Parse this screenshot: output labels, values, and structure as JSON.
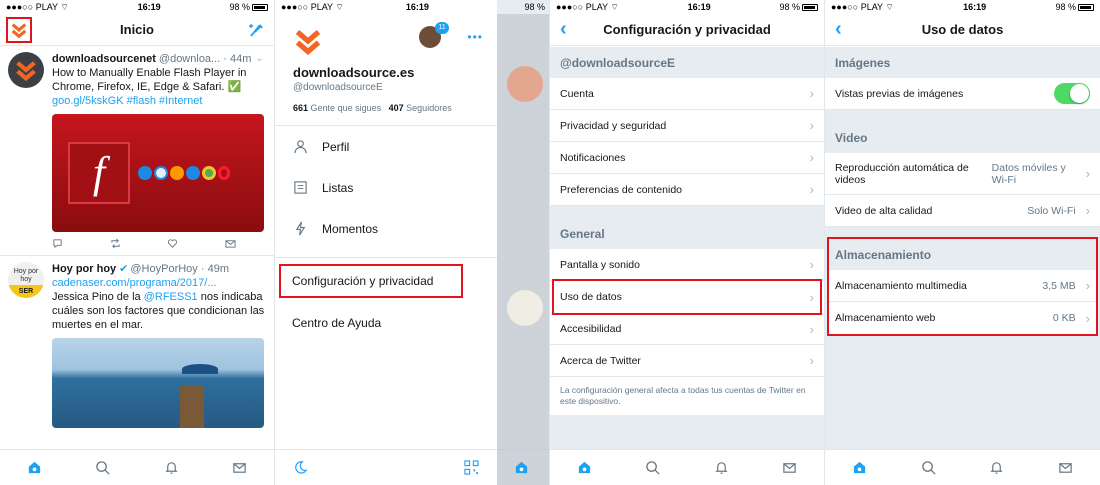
{
  "status": {
    "carrier": "PLAY",
    "time": "16:19",
    "battery": "98 %"
  },
  "screen1": {
    "title": "Inicio",
    "tweets": [
      {
        "name": "downloadsourcenet",
        "handle": "@downloa...",
        "time": "44m",
        "text": "How to Manually Enable Flash Player in Chrome, Firefox, IE, Edge & Safari. ✅",
        "link": "goo.gl/5kskGK #flash #Internet"
      },
      {
        "name": "Hoy por hoy",
        "handle": "@HoyPorHoy",
        "time": "49m",
        "avatar_text": "Hoy por hoy",
        "avatar_badge": "SER",
        "link": "cadenaser.com/programa/2017/...",
        "text_before": "Jessica Pino de la ",
        "mention": "@RFESS1",
        "text_after": " nos indicaba cuáles son los factores que condicionan las muertes en el mar."
      }
    ]
  },
  "screen2": {
    "account_name": "downloadsource.es",
    "account_handle": "@downloadsourceE",
    "following_count": "661",
    "following_label": "Gente que sigues",
    "followers_count": "407",
    "followers_label": "Seguidores",
    "notif_count": "11",
    "menu": [
      "Perfil",
      "Listas",
      "Momentos"
    ],
    "settings_label": "Configuración y privacidad",
    "help_label": "Centro de Ayuda"
  },
  "screen3": {
    "title": "Configuración y privacidad",
    "account_section": "@downloadsourceE",
    "account_rows": [
      "Cuenta",
      "Privacidad y seguridad",
      "Notificaciones",
      "Preferencias de contenido"
    ],
    "general_section": "General",
    "general_rows": [
      "Pantalla y sonido",
      "Uso de datos",
      "Accesibilidad",
      "Acerca de Twitter"
    ],
    "note": "La configuración general afecta a todas tus cuentas de Twitter en este dispositivo."
  },
  "screen4": {
    "title": "Uso de datos",
    "images_section": "Imágenes",
    "image_preview_label": "Vistas previas de imágenes",
    "image_preview_on": true,
    "video_section": "Video",
    "autoplay_label": "Reproducción automática de videos",
    "autoplay_value": "Datos móviles y Wi-Fi",
    "hq_label": "Video de alta calidad",
    "hq_value": "Solo Wi-Fi",
    "storage_section": "Almacenamiento",
    "media_storage_label": "Almacenamiento multimedia",
    "media_storage_value": "3,5 MB",
    "web_storage_label": "Almacenamiento web",
    "web_storage_value": "0 KB"
  },
  "colors": {
    "accent": "#1da1f2",
    "highlight": "#e0141e",
    "logo": "#f26522",
    "toggle_on": "#4cd964"
  }
}
